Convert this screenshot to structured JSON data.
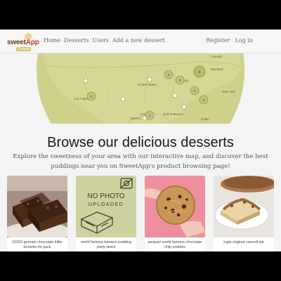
{
  "navbar": {
    "logo": {
      "brand_part1": "sweet",
      "brand_part2": "App",
      "tagline": "Dessert"
    },
    "links": [
      "Home",
      "Desserts",
      "Users",
      "Add a new dessert"
    ],
    "right_links": [
      "Register",
      "Log in"
    ]
  },
  "map": {
    "labels": [
      "Canada",
      "United States",
      "Mexico",
      "Gulf of Mexico",
      "Cuba",
      "Los Angeles",
      "Chicago",
      "Montreal",
      "New York",
      "Houston"
    ],
    "clusters": [
      "2",
      "2",
      "8",
      "4",
      "2",
      "5",
      "4",
      "2"
    ],
    "colors": {
      "overlay": "#c8c97a",
      "map_base": "#e6e6d6"
    }
  },
  "hero": {
    "title": "Browse our delicious desserts",
    "description": "Explore the sweetness of your area with our interactive map, and discover the best puddings near you on SweetApp's product browsing page!"
  },
  "cards": [
    {
      "caption": "15253 german chocolate killer brownie tin pack",
      "image": "brownie-photo"
    },
    {
      "caption": "world famous banana pudding party sized",
      "image": "no-photo-placeholder",
      "placeholder_line1": "NO PHOTO",
      "placeholder_line2": "UPLOADED"
    },
    {
      "caption": "jacques world famous chocolate chip cookies",
      "image": "cookie-photo"
    },
    {
      "caption": "tugis original cannoli pie",
      "image": "pie-photo"
    }
  ]
}
